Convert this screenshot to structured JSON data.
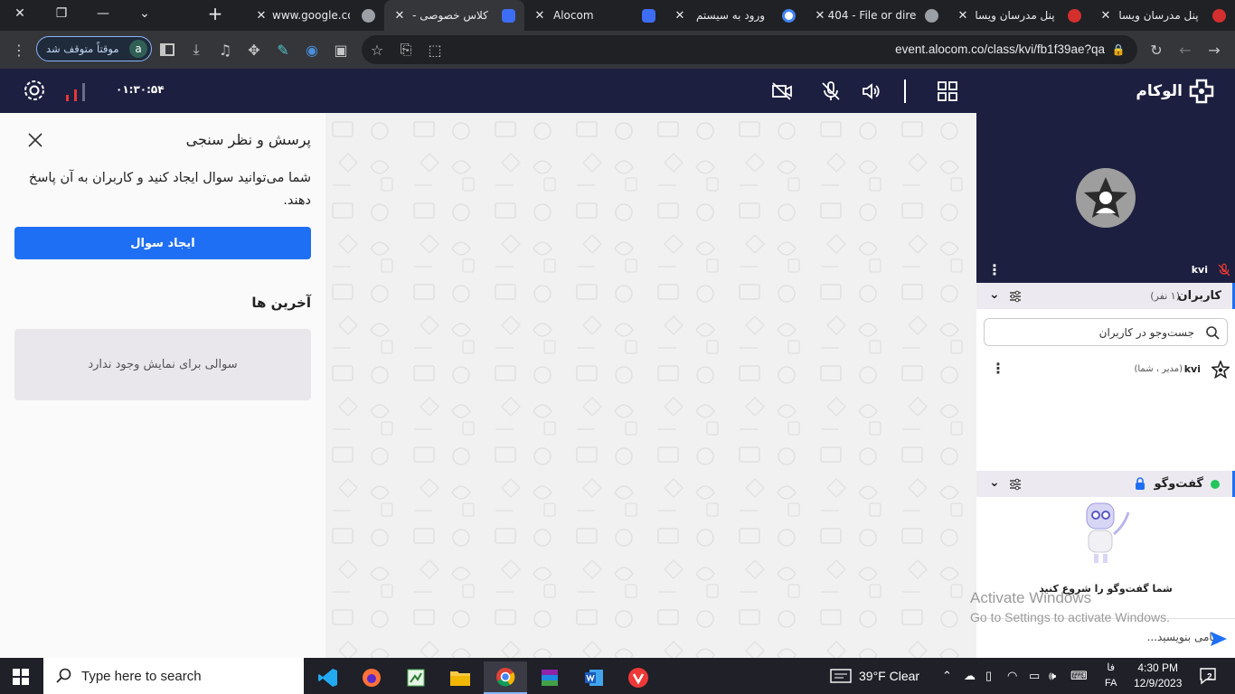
{
  "browser": {
    "tabs": [
      {
        "title": "پنل مدرسان ویسا",
        "favicon_color": "#d32f2f"
      },
      {
        "title": "پنل مدرسان ویسا",
        "favicon_color": "#d32f2f"
      },
      {
        "title": "404 - File or dire",
        "favicon_color": "#9aa0a6"
      },
      {
        "title": "ورود به سیستم",
        "favicon_color": "#4285f4"
      },
      {
        "title": "Alocom",
        "favicon_color": "#3d6df2"
      },
      {
        "title": "کلاس خصوصی -",
        "favicon_color": "#3d6df2",
        "active": true
      },
      {
        "title": "www.google.com",
        "favicon_color": "#9aa0a6"
      }
    ],
    "url": "event.alocom.co/class/kvi/fb1f39ae?qa",
    "profile_status": "موقتاً متوقف شد",
    "profile_initial": "a"
  },
  "app": {
    "brand": "الوکام",
    "timer": "۰۱:۳۰:۵۴",
    "accent": "#1f6ff4",
    "header_bg": "#1c1f3f"
  },
  "poll": {
    "title": "پرسش و نظر سنجی",
    "description": "شما می‌توانید سوال ایجاد کنید و کاربران به آن پاسخ دهند.",
    "create_button": "ایجاد سوال",
    "recent_title": "آخرین ها",
    "empty_message": "سوالی برای نمایش وجود ندارد"
  },
  "video_tile": {
    "name": "kvi"
  },
  "users": {
    "title": "کاربران",
    "count": "(۱ نفر)",
    "search_placeholder": "جست‌وجو در کاربران",
    "list": [
      {
        "name": "kvi",
        "role": "(مدیر ، شما)"
      }
    ]
  },
  "chat": {
    "title": "گفت‌وگو",
    "empty_message": "شما گفت‌وگو را شروع کنید",
    "input_placeholder": "پیامی بنویسید..."
  },
  "watermark": {
    "line1": "Activate Windows",
    "line2": "Go to Settings to activate Windows."
  },
  "taskbar": {
    "search_placeholder": "Type here to search",
    "weather": "39°F  Clear",
    "lang_top": "فا",
    "lang_bottom": "FA",
    "time": "4:30 PM",
    "date": "12/9/2023",
    "notifications": "2"
  }
}
